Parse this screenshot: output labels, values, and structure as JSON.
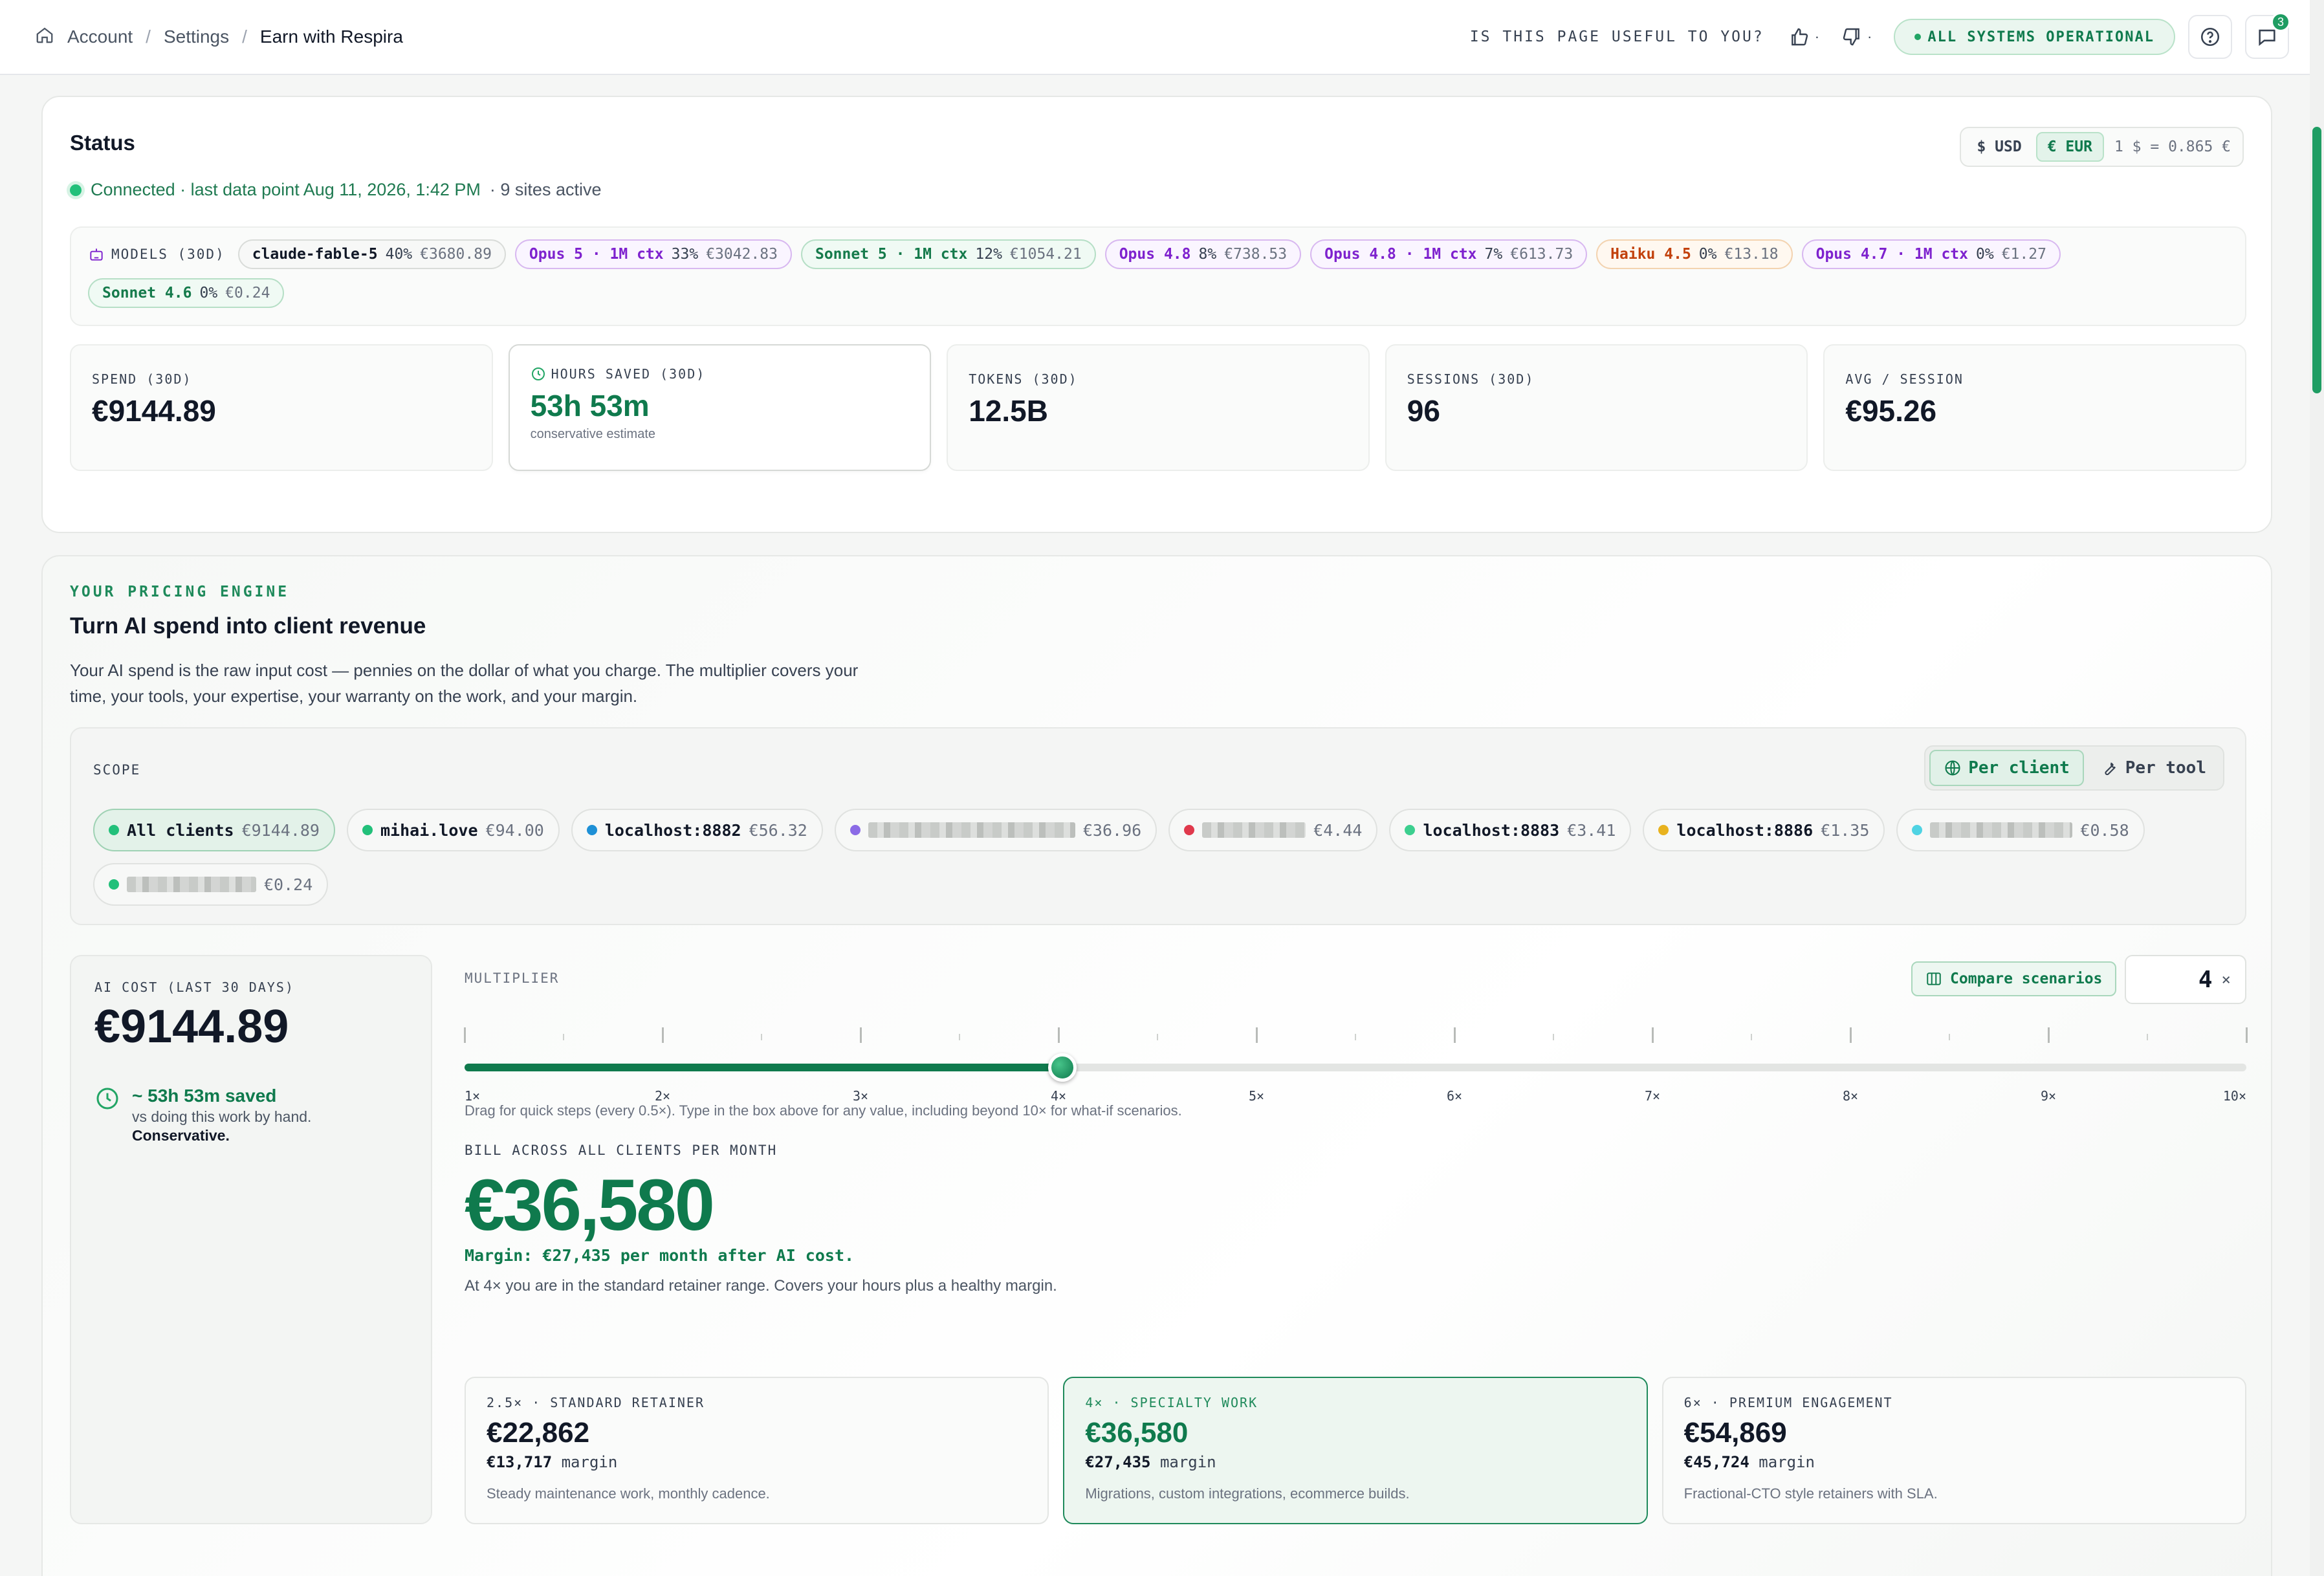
{
  "breadcrumb": [
    "Account",
    "Settings",
    "Earn with Respira"
  ],
  "topbar": {
    "useful_question": "IS THIS PAGE USEFUL TO YOU?",
    "thumbs_up_count": "·",
    "thumbs_down_count": "·",
    "system_status": "ALL SYSTEMS OPERATIONAL",
    "notification_count": "3"
  },
  "status": {
    "title": "Status",
    "connection": "Connected · last data point Aug 11, 2026, 1:42 PM",
    "sites": "· 9 sites active",
    "currency": {
      "usd": "$ USD",
      "eur": "€ EUR",
      "rate": "1 $ = 0.865 €",
      "selected": "EUR"
    },
    "models_label": "MODELS (30D)",
    "models": [
      {
        "name": "claude-fable-5",
        "pct": "40%",
        "cost": "€3680.89",
        "tone": "neutral"
      },
      {
        "name": "Opus 5 · 1M ctx",
        "pct": "33%",
        "cost": "€3042.83",
        "tone": "purple"
      },
      {
        "name": "Sonnet 5 · 1M ctx",
        "pct": "12%",
        "cost": "€1054.21",
        "tone": "green"
      },
      {
        "name": "Opus 4.8",
        "pct": "8%",
        "cost": "€738.53",
        "tone": "purple"
      },
      {
        "name": "Opus 4.8 · 1M ctx",
        "pct": "7%",
        "cost": "€613.73",
        "tone": "purple"
      },
      {
        "name": "Haiku 4.5",
        "pct": "0%",
        "cost": "€13.18",
        "tone": "orange"
      },
      {
        "name": "Opus 4.7 · 1M ctx",
        "pct": "0%",
        "cost": "€1.27",
        "tone": "purple"
      },
      {
        "name": "Sonnet 4.6",
        "pct": "0%",
        "cost": "€0.24",
        "tone": "green"
      }
    ],
    "stats": [
      {
        "label": "SPEND (30D)",
        "value": "€9144.89",
        "note": ""
      },
      {
        "label": "HOURS SAVED (30D)",
        "value": "53h 53m",
        "note": "conservative estimate"
      },
      {
        "label": "TOKENS (30D)",
        "value": "12.5B",
        "note": ""
      },
      {
        "label": "SESSIONS (30D)",
        "value": "96",
        "note": ""
      },
      {
        "label": "AVG / SESSION",
        "value": "€95.26",
        "note": ""
      }
    ]
  },
  "pricing": {
    "eyebrow": "YOUR PRICING ENGINE",
    "title": "Turn AI spend into client revenue",
    "description": "Your AI spend is the raw input cost — pennies on the dollar of what you charge. The multiplier covers your time, your tools, your expertise, your warranty on the work, and your margin.",
    "scope": {
      "label": "SCOPE",
      "per_client": "Per client",
      "per_tool": "Per tool",
      "selected": "per_client",
      "clients": [
        {
          "name": "All clients",
          "amount": "€9144.89",
          "color": "#22c07a",
          "redacted": false,
          "active": true
        },
        {
          "name": "mihai.love",
          "amount": "€94.00",
          "color": "#22c07a",
          "redacted": false,
          "active": false
        },
        {
          "name": "localhost:8882",
          "amount": "€56.32",
          "color": "#1e90d6",
          "redacted": false,
          "active": false
        },
        {
          "name": "",
          "amount": "€36.96",
          "color": "#8b6be6",
          "redacted": true,
          "active": false
        },
        {
          "name": "",
          "amount": "€4.44",
          "color": "#e0394c",
          "redacted": true,
          "active": false
        },
        {
          "name": "localhost:8883",
          "amount": "€3.41",
          "color": "#3ccf8f",
          "redacted": false,
          "active": false
        },
        {
          "name": "localhost:8886",
          "amount": "€1.35",
          "color": "#e8b21e",
          "redacted": false,
          "active": false
        },
        {
          "name": "",
          "amount": "€0.58",
          "color": "#4fd3e3",
          "redacted": true,
          "active": false
        },
        {
          "name": "",
          "amount": "€0.24",
          "color": "#22c07a",
          "redacted": true,
          "active": false
        }
      ]
    },
    "ai_cost": {
      "label": "AI COST (LAST 30 DAYS)",
      "value": "€9144.89",
      "saved": "~ 53h 53m saved",
      "saved_note": "vs doing this work by hand.",
      "saved_strong": "Conservative."
    },
    "multiplier": {
      "label": "MULTIPLIER",
      "compare": "Compare scenarios",
      "value": "4",
      "suffix": "×",
      "min": 1,
      "max": 10,
      "current": 4,
      "tick_labels": [
        "1×",
        "2×",
        "3×",
        "4×",
        "5×",
        "6×",
        "7×",
        "8×",
        "9×",
        "10×"
      ],
      "hint": "Drag for quick steps (every 0.5×). Type in the box above for any value, including beyond 10× for what-if scenarios."
    },
    "bill": {
      "label": "BILL ACROSS ALL CLIENTS PER MONTH",
      "value": "€36,580",
      "margin": "Margin: €27,435 per month after AI cost.",
      "description": "At 4× you are in the standard retainer range. Covers your hours plus a healthy margin."
    },
    "tiers": [
      {
        "label": "2.5× · STANDARD RETAINER",
        "price": "€22,862",
        "margin_value": "€13,717",
        "margin_word": "margin",
        "desc": "Steady maintenance work, monthly cadence.",
        "active": false
      },
      {
        "label": "4× · SPECIALTY WORK",
        "price": "€36,580",
        "margin_value": "€27,435",
        "margin_word": "margin",
        "desc": "Migrations, custom integrations, ecommerce builds.",
        "active": true
      },
      {
        "label": "6× · PREMIUM ENGAGEMENT",
        "price": "€54,869",
        "margin_value": "€45,724",
        "margin_word": "margin",
        "desc": "Fractional-CTO style retainers with SLA.",
        "active": false
      }
    ]
  }
}
